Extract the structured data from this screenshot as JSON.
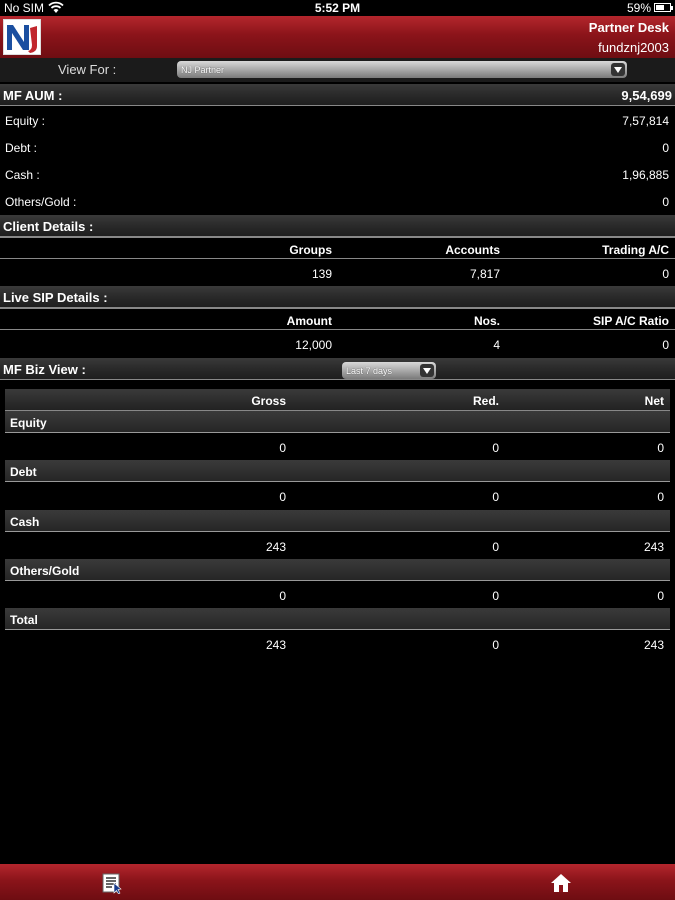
{
  "status_bar": {
    "carrier": "No SIM",
    "time": "5:52 PM",
    "battery": "59%"
  },
  "header": {
    "title": "Partner Desk",
    "user": "fundznj2003",
    "logo_icon": "nj-logo-icon"
  },
  "view_for": {
    "label": "View For :",
    "selected": "NJ Partner"
  },
  "mf_aum": {
    "label": "MF AUM :",
    "total": "9,54,699",
    "rows": [
      {
        "label": "Equity :",
        "value": "7,57,814"
      },
      {
        "label": "Debt :",
        "value": "0"
      },
      {
        "label": "Cash :",
        "value": "1,96,885"
      },
      {
        "label": "Others/Gold :",
        "value": "0"
      }
    ]
  },
  "client_details": {
    "label": "Client Details :",
    "columns": [
      "Groups",
      "Accounts",
      "Trading A/C"
    ],
    "values": [
      "139",
      "7,817",
      "0"
    ]
  },
  "live_sip": {
    "label": "Live SIP Details :",
    "columns": [
      "Amount",
      "Nos.",
      "SIP A/C Ratio"
    ],
    "values": [
      "12,000",
      "4",
      "0"
    ]
  },
  "mf_biz": {
    "label": "MF Biz View :",
    "period": "Last 7 days",
    "columns": [
      "Gross",
      "Red.",
      "Net"
    ],
    "categories": [
      {
        "name": "Equity",
        "values": [
          "0",
          "0",
          "0"
        ]
      },
      {
        "name": "Debt",
        "values": [
          "0",
          "0",
          "0"
        ]
      },
      {
        "name": "Cash",
        "values": [
          "243",
          "0",
          "243"
        ]
      },
      {
        "name": "Others/Gold",
        "values": [
          "0",
          "0",
          "0"
        ]
      },
      {
        "name": "Total",
        "values": [
          "243",
          "0",
          "243"
        ]
      }
    ]
  },
  "bottom_bar": {
    "left_icon": "report-icon",
    "right_icon": "home-icon"
  },
  "colors": {
    "header_red": "#8b141a",
    "background": "#000000"
  }
}
